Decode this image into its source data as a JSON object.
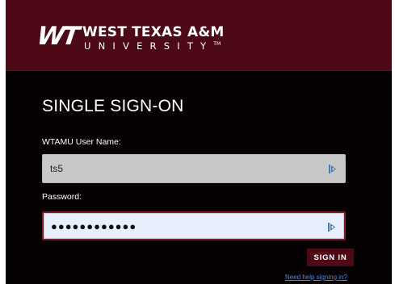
{
  "brand": {
    "logo_mark": "WT",
    "name_line1": "WEST TEXAS A&M",
    "name_line2": "UNIVERSITY",
    "trademark": "TM"
  },
  "login": {
    "title": "SINGLE SIGN-ON",
    "username_label": "WTAMU User Name:",
    "username_value": "ts5",
    "password_label": "Password:",
    "password_mask": "●●●●●●●●●●●●",
    "signin_label": "SIGN IN",
    "help_link": "Need help signing in?"
  },
  "colors": {
    "brand_maroon": "#4d0a16",
    "page_bg": "#060204",
    "link_blue": "#4a8ae0"
  },
  "icons": {
    "field_icon": "password-manager-icon"
  }
}
